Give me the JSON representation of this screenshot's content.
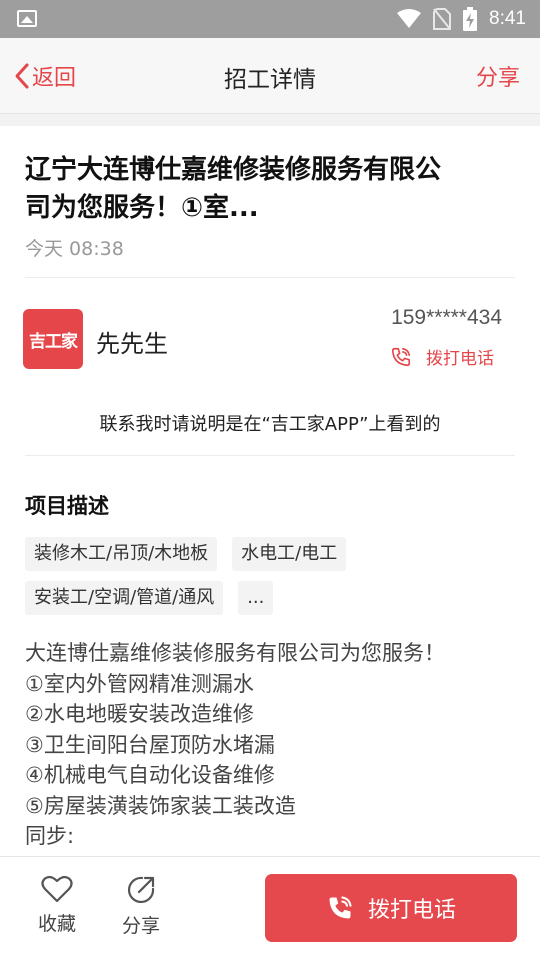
{
  "status_bar": {
    "time": "8:41"
  },
  "nav": {
    "back_label": "返回",
    "title": "招工详情",
    "share_label": "分享"
  },
  "job": {
    "title_line1": "辽宁大连博仕嘉维修装修服务有限公",
    "title_line2": "司为您服务！①室...",
    "posted_time": "今天 08:38"
  },
  "contact": {
    "logo_text": "吉工家",
    "name": "先先生",
    "phone": "159*****434",
    "call_label": "拨打电话",
    "notice": "联系我时请说明是在“吉工家APP”上看到的"
  },
  "project": {
    "section_title": "项目描述",
    "tags": [
      "装修木工/吊顶/木地板",
      "水电工/电工",
      "安装工/空调/管道/通风",
      "..."
    ],
    "description_lines": [
      "大连博仕嘉维修装修服务有限公司为您服务！",
      "①室内外管网精准测漏水",
      "②水电地暖安装改造维修",
      "③卫生间阳台屋顶防水堵漏",
      "④机械电气自动化设备维修",
      "⑤房屋装潢装饰家装工装改造",
      "同步:"
    ]
  },
  "bottom_bar": {
    "favorite_label": "收藏",
    "share_label": "分享",
    "call_button_label": "拨打电话"
  },
  "colors": {
    "accent": "#e5464a",
    "status_bar": "#9e9e9e"
  },
  "icons": [
    "gallery-icon",
    "wifi-icon",
    "no-sim-icon",
    "battery-charging-icon",
    "chevron-left-icon",
    "phone-icon",
    "heart-icon",
    "share-icon"
  ]
}
